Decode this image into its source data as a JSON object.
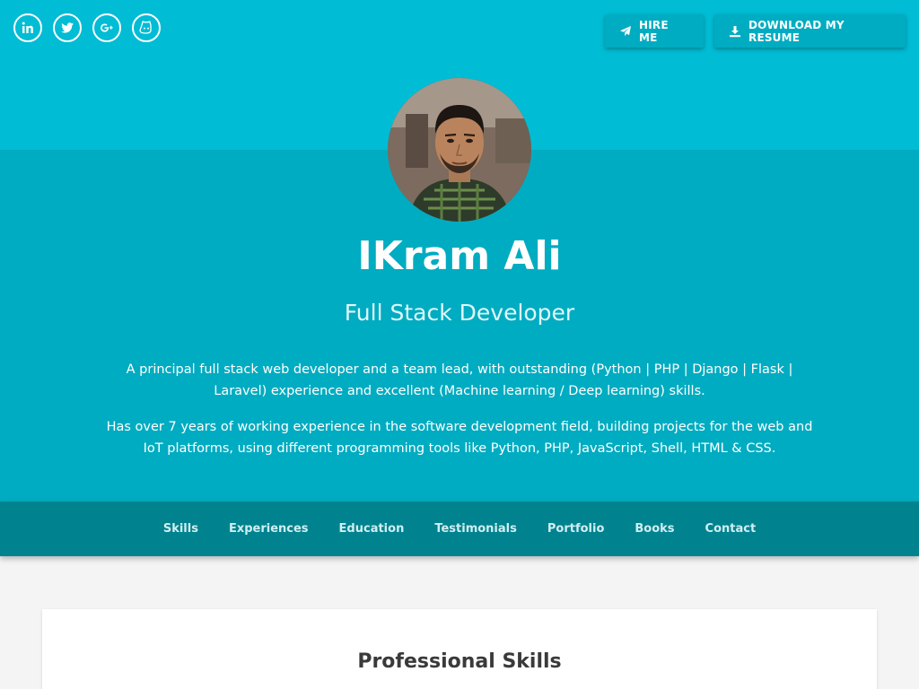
{
  "social": [
    {
      "icon": "linkedin-icon",
      "label": "in"
    },
    {
      "icon": "twitter-icon",
      "label": ""
    },
    {
      "icon": "google-plus-icon",
      "label": "G+"
    },
    {
      "icon": "github-icon",
      "label": ""
    }
  ],
  "actions": {
    "hire_label": "HIRE ME",
    "hire_icon": "paper-plane-icon",
    "resume_label": "DOWNLOAD MY RESUME",
    "resume_icon": "download-icon"
  },
  "profile": {
    "name": "IKram Ali",
    "role": "Full Stack Developer",
    "bio": [
      "A principal full stack web developer and a team lead, with outstanding (Python | PHP | Django | Flask | Laravel) experience and excellent (Machine learning / Deep learning) skills.",
      "Has over 7 years of working experience in the software development field, building projects for the web and IoT platforms, using different programming tools like Python, PHP, JavaScript, Shell, HTML & CSS."
    ]
  },
  "nav": [
    "Skills",
    "Experiences",
    "Education",
    "Testimonials",
    "Portfolio",
    "Books",
    "Contact"
  ],
  "section": {
    "title": "Professional Skills"
  },
  "colors": {
    "header_top": "#00bcd4",
    "header_main": "#00acc1",
    "navbar": "#00838f",
    "background": "#f4f4f4"
  }
}
